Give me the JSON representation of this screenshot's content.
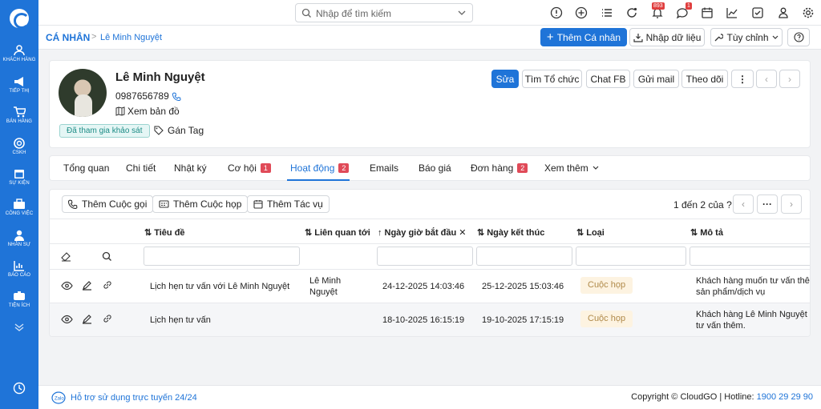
{
  "sidebar": {
    "items": [
      {
        "label": "KHÁCH HÀNG",
        "icon": "users-icon"
      },
      {
        "label": "TIẾP THỊ",
        "icon": "megaphone-icon"
      },
      {
        "label": "BÁN HÀNG",
        "icon": "cart-icon"
      },
      {
        "label": "CSKH",
        "icon": "lifebuoy-icon"
      },
      {
        "label": "SỰ KIỆN",
        "icon": "calendar-icon"
      },
      {
        "label": "CÔNG VIỆC",
        "icon": "briefcase-icon"
      },
      {
        "label": "NHÂN SỰ",
        "icon": "person-icon"
      },
      {
        "label": "BÁO CÁO",
        "icon": "report-icon"
      },
      {
        "label": "TIỆN ÍCH",
        "icon": "utilities-icon"
      }
    ]
  },
  "topbar": {
    "search_placeholder": "Nhập để tìm kiếm",
    "notifications_count": "893",
    "messages_count": "1"
  },
  "breadcrumb": {
    "root": "CÁ NHÂN",
    "separator": ">",
    "current": "Lê Minh Nguyệt"
  },
  "header_actions": {
    "add": "Thêm Cá nhân",
    "import": "Nhập dữ liệu",
    "custom": "Tùy chỉnh"
  },
  "profile": {
    "name": "Lê Minh Nguyệt",
    "phone": "0987656789",
    "map_label": "Xem bản đồ",
    "survey_badge": "Đã tham gia khảo sát",
    "tag_label": "Gán Tag",
    "actions": {
      "edit": "Sửa",
      "find_org": "Tìm Tổ chức",
      "chat_fb": "Chat FB",
      "send_mail": "Gửi mail",
      "follow": "Theo dõi"
    }
  },
  "tabs": [
    {
      "label": "Tổng quan"
    },
    {
      "label": "Chi tiết"
    },
    {
      "label": "Nhật ký"
    },
    {
      "label": "Cơ hội",
      "count": "1"
    },
    {
      "label": "Hoạt động",
      "count": "2"
    },
    {
      "label": "Emails"
    },
    {
      "label": "Báo giá"
    },
    {
      "label": "Đơn hàng",
      "count": "2"
    },
    {
      "label": "Xem thêm"
    }
  ],
  "activity": {
    "buttons": {
      "add_call": "Thêm Cuộc gọi",
      "add_meeting": "Thêm Cuộc họp",
      "add_task": "Thêm Tác vụ"
    },
    "pager_text": "1 đến 2 của",
    "pager_more": "?",
    "columns": [
      "Tiêu đề",
      "Liên quan tới",
      "Ngày giờ bắt đầu",
      "Ngày kết thúc",
      "Loại",
      "Mô tả"
    ],
    "rows": [
      {
        "title": "Lịch hẹn tư vấn với Lê Minh Nguyệt",
        "related_line1": "Lê Minh",
        "related_line2": "Nguyệt",
        "start": "24-12-2025 14:03:46",
        "end": "25-12-2025 15:03:46",
        "type": "Cuộc họp",
        "desc_line1": "Khách hàng muốn tư vấn thêm",
        "desc_line2": "sản phẩm/dịch vụ"
      },
      {
        "title": "Lịch hẹn tư vấn",
        "related_line1": "",
        "related_line2": "",
        "start": "18-10-2025 16:15:19",
        "end": "19-10-2025 17:15:19",
        "type": "Cuộc họp",
        "desc_line1": "Khách hàng Lê Minh Nguyệt",
        "desc_line2": "tư vấn thêm."
      }
    ]
  },
  "footer": {
    "support": "Hỗ trợ sử dụng trực tuyến 24/24",
    "copyright": "Copyright © CloudGO | Hotline: ",
    "hotline": "1900 29 29 90"
  },
  "colors": {
    "primary": "#1f74d8",
    "badge": "#e04a58",
    "pill_bg": "#fdf3e1"
  }
}
